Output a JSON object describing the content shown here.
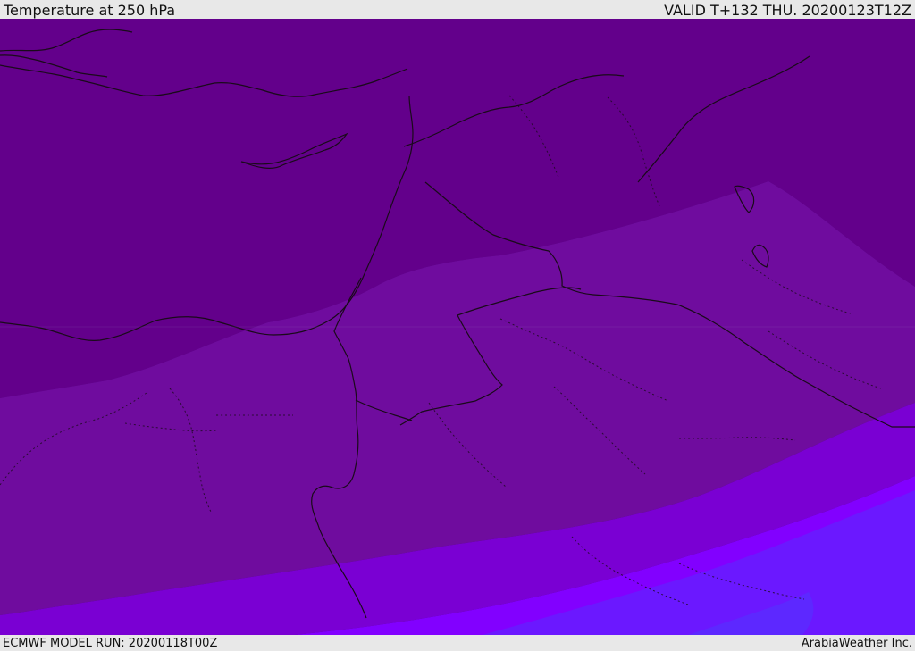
{
  "header": {
    "title": "Temperature at 250 hPa",
    "valid": "VALID T+132 THU. 20200123T12Z"
  },
  "footer": {
    "model_run": "ECMWF MODEL RUN: 20200118T00Z",
    "credit": "ArabiaWeather Inc."
  },
  "map": {
    "field_colors": [
      "#4b0073",
      "#57007f",
      "#63008b",
      "#6f0c9e",
      "#7a00d3",
      "#8200ff",
      "#6b18ff",
      "#5d28ff"
    ]
  }
}
